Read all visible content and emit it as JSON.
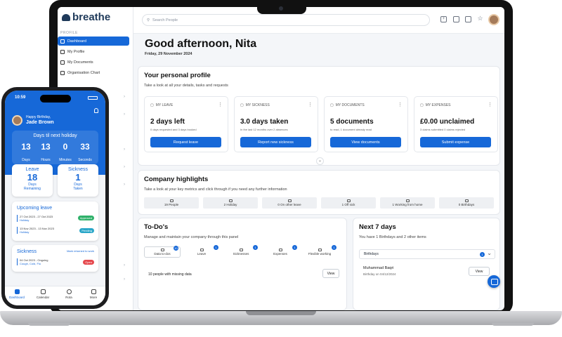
{
  "brand": {
    "logo": "breathe",
    "accent": "#1668d8"
  },
  "sidebar": {
    "section_label": "PROFILE",
    "items": [
      {
        "label": "Dashboard",
        "icon": "dashboard-icon",
        "active": true
      },
      {
        "label": "My Profile",
        "icon": "person-icon"
      },
      {
        "label": "My Documents",
        "icon": "document-icon"
      },
      {
        "label": "Organisation Chart",
        "icon": "org-chart-icon"
      }
    ]
  },
  "topbar": {
    "search_placeholder": "Search People",
    "icons": [
      "add-person-icon",
      "calendar-icon",
      "calendar-icon",
      "star-icon",
      "avatar"
    ]
  },
  "header": {
    "greeting": "Good afternoon, Nita",
    "date": "Friday, 29 November 2024"
  },
  "personal_profile": {
    "title": "Your personal profile",
    "subtitle": "Take a look at all your details, tasks and requests",
    "cards": [
      {
        "label": "MY LEAVE",
        "icon": "calendar-icon",
        "value": "2 days left",
        "detail": "0 days requested and 3 days booked",
        "button": "Request leave"
      },
      {
        "label": "MY SICKNESS",
        "icon": "thermometer-icon",
        "value": "3.0 days taken",
        "detail": "In the last 12 months over 2 absences",
        "button": "Report new sickness"
      },
      {
        "label": "MY DOCUMENTS",
        "icon": "document-icon",
        "value": "5 documents",
        "detail": "to read, 1 document already read",
        "button": "View documents"
      },
      {
        "label": "MY EXPENSES",
        "icon": "receipt-icon",
        "value": "£0.00 unclaimed",
        "detail": "3 claims submitted 0 claims rejected",
        "button": "Submit expense"
      }
    ]
  },
  "highlights": {
    "title": "Company highlights",
    "subtitle": "Take a look at your key metrics and click through if you need any further information",
    "items": [
      "19 People",
      "2 Holiday",
      "0 On other leave",
      "1 Off sick",
      "1 Working from home",
      "0 Birthdays"
    ]
  },
  "todos": {
    "title": "To-Do's",
    "subtitle": "Manage and maintain your company through this panel",
    "tabs": [
      {
        "label": "Data to-dos",
        "count": "10"
      },
      {
        "label": "Leave",
        "count": "1"
      },
      {
        "label": "Sicknesses",
        "count": "1"
      },
      {
        "label": "Expenses",
        "count": "1"
      },
      {
        "label": "Flexible working",
        "count": "1"
      }
    ],
    "row_text": "10 people with missing data",
    "row_button": "View"
  },
  "next7": {
    "title": "Next 7 days",
    "subtitle": "You have 1 Birthdays and 2 other items",
    "select_label": "Birthdays",
    "select_count": "1",
    "person_name": "Muhammad Baqri",
    "person_detail": "Birthday on 04/12/2024",
    "button": "View"
  },
  "phone": {
    "time": "10:59",
    "birthday_label": "Happy Birthday,",
    "name": "Jade Brown",
    "countdown_title": "Days til next holiday",
    "countdown": [
      {
        "value": "13",
        "unit": "Days"
      },
      {
        "value": "13",
        "unit": "Hours"
      },
      {
        "value": "0",
        "unit": "Minutes"
      },
      {
        "value": "33",
        "unit": "Seconds"
      }
    ],
    "leave": {
      "title": "Leave",
      "value": "18",
      "line1": "Days",
      "line2": "Remaining"
    },
    "sickness": {
      "title": "Sickness",
      "value": "1",
      "line1": "Days",
      "line2": "Taken"
    },
    "upcoming": {
      "title": "Upcoming leave",
      "items": [
        {
          "dates": "27 Oct 2023 - 27 Oct 2023",
          "kind": "Holiday",
          "status": "Approved",
          "status_color": "#2fb16a"
        },
        {
          "dates": "13 Nov 2023 - 13 Nov 2023",
          "kind": "Holiday",
          "status": "Pending",
          "status_color": "#29a6c8"
        }
      ]
    },
    "sick_card": {
      "title": "Sickness",
      "link": "Mark returned to work",
      "dates": "04 Oct 2023 - Ongoing",
      "detail": "Cough, Cold, Flu",
      "status": "Open",
      "status_color": "#e5484d"
    },
    "nav": [
      "Dashboard",
      "Calendar",
      "Rota",
      "More"
    ]
  }
}
